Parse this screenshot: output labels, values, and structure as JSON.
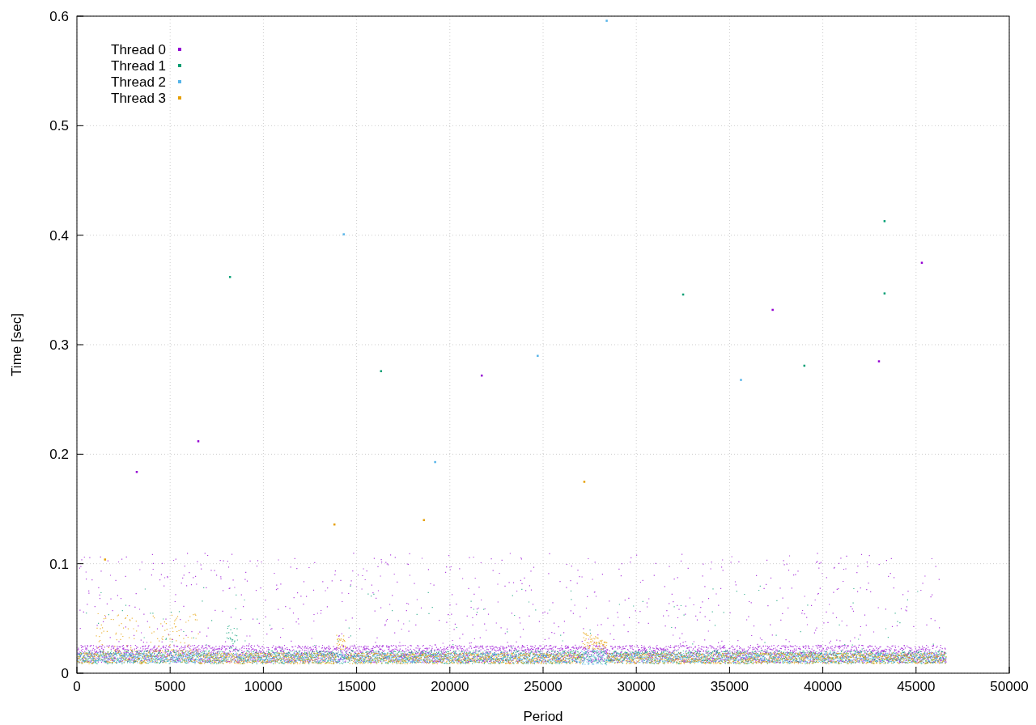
{
  "chart_data": {
    "type": "scatter",
    "xlabel": "Period",
    "ylabel": "Time [sec]",
    "xlim": [
      0,
      50000
    ],
    "ylim": [
      0,
      0.6
    ],
    "xticks": [
      0,
      5000,
      10000,
      15000,
      20000,
      25000,
      30000,
      35000,
      40000,
      45000,
      50000
    ],
    "yticks": [
      0,
      0.1,
      0.2,
      0.3,
      0.4,
      0.5,
      0.6
    ],
    "grid": true,
    "legend": true,
    "series": [
      {
        "name": "Thread 0",
        "color": "#9400d3",
        "x": [
          3200,
          6500,
          21700,
          37300,
          45300,
          43000
        ],
        "values": [
          0.184,
          0.212,
          0.272,
          0.332,
          0.375,
          0.285
        ]
      },
      {
        "name": "Thread 1",
        "color": "#009e73",
        "x": [
          8200,
          16300,
          32500,
          43300,
          43300,
          39000
        ],
        "values": [
          0.362,
          0.276,
          0.346,
          0.413,
          0.347,
          0.281
        ]
      },
      {
        "name": "Thread 2",
        "color": "#56b4e9",
        "x": [
          14300,
          24700,
          28400,
          35600,
          19200
        ],
        "values": [
          0.401,
          0.29,
          0.596,
          0.268,
          0.193
        ]
      },
      {
        "name": "Thread 3",
        "color": "#e69f00",
        "x": [
          1500,
          13800,
          18600,
          27200
        ],
        "values": [
          0.104,
          0.136,
          0.14,
          0.175
        ]
      }
    ]
  }
}
